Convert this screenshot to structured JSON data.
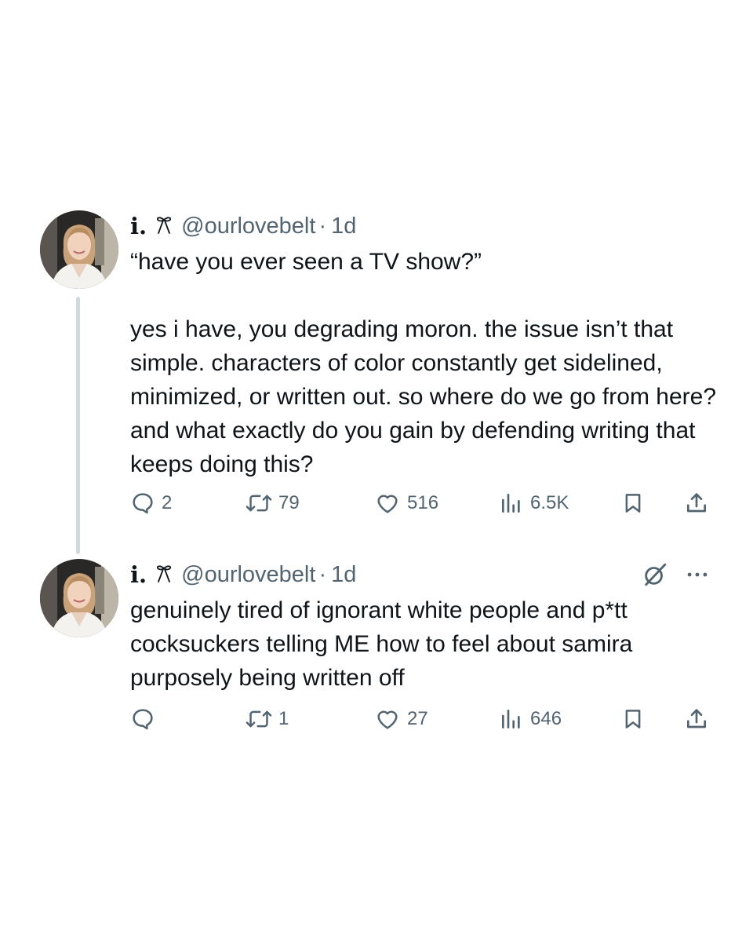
{
  "tweets": [
    {
      "display_name": "i.",
      "badge_icon": "bow-icon",
      "handle": "@ourlovebelt",
      "separator": "·",
      "time": "1d",
      "quote_line": "“have you ever seen a TV show?”",
      "body": "yes i have, you degrading moron. the issue isn’t that simple. characters of color constantly get sidelined, minimized, or written out. so where do we go from here? and what exactly do you gain by defending writing that keeps doing this?",
      "actions": {
        "replies": "2",
        "reposts": "79",
        "likes": "516",
        "views": "6.5K"
      }
    },
    {
      "display_name": "i.",
      "badge_icon": "bow-icon",
      "handle": "@ourlovebelt",
      "separator": "·",
      "time": "1d",
      "body": "genuinely tired of ignorant white people and p*tt cocksuckers telling ME how to feel about samira purposely being written off",
      "actions": {
        "replies": "",
        "reposts": "1",
        "likes": "27",
        "views": "646"
      }
    }
  ],
  "icons": {
    "reply": "reply-icon",
    "repost": "repost-icon",
    "like": "heart-icon",
    "views": "views-icon",
    "bookmark": "bookmark-icon",
    "share": "share-icon",
    "grok": "grok-icon",
    "more": "more-icon"
  },
  "colors": {
    "text": "#0f1419",
    "secondary": "#536471",
    "thread_line": "#cfd9de",
    "background": "#ffffff"
  }
}
